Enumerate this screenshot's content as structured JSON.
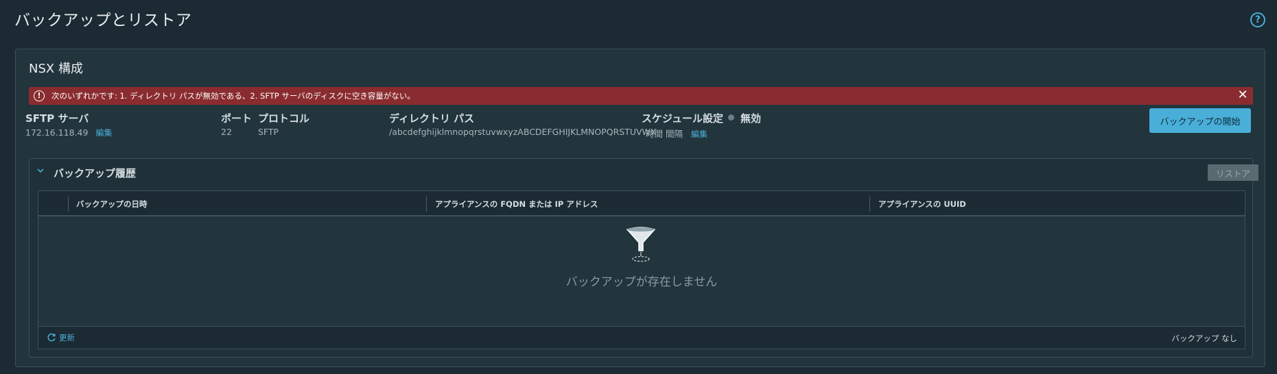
{
  "page": {
    "title": "バックアップとリストア"
  },
  "card": {
    "title": "NSX 構成",
    "alert": {
      "message": "次のいずれかです: 1. ディレクトリ パスが無効である、2. SFTP サーバのディスクに空き容量がない。",
      "color": "#8a2c2f"
    },
    "fields": {
      "sftp": {
        "label": "SFTP サーバ",
        "value": "172.16.118.49",
        "edit": "編集"
      },
      "port": {
        "label": "ポート",
        "value": "22"
      },
      "protocol": {
        "label": "プロトコル",
        "value": "SFTP"
      },
      "directory": {
        "label": "ディレクトリ パス",
        "value": "/abcdefghijklmnopqrstuvwxyzABCDEFGHIJKLMNOPQRSTUVWXYZ"
      },
      "schedule": {
        "label": "スケジュール設定",
        "status": "無効",
        "value": "時間 間隔",
        "edit": "編集"
      }
    },
    "start_button": "バックアップの開始",
    "accent": "#49afd9"
  },
  "history": {
    "title": "バックアップ履歴",
    "restore_button": "リストア",
    "columns": [
      "バックアップの日時",
      "アプライアンスの FQDN または IP アドレス",
      "アプライアンスの UUID"
    ],
    "empty_message": "バックアップが存在しません",
    "refresh": "更新",
    "footer": "バックアップ なし"
  }
}
